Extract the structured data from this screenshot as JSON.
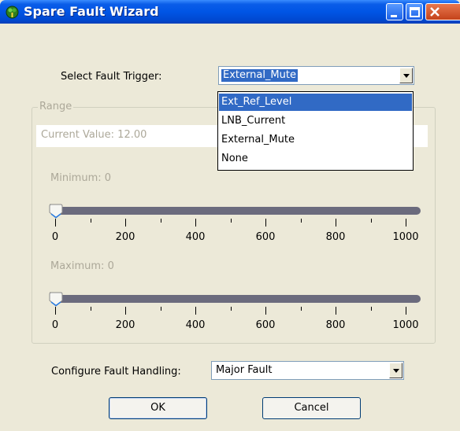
{
  "window": {
    "title": "Spare Fault Wizard"
  },
  "trigger": {
    "label": "Select Fault Trigger:",
    "value": "External_Mute",
    "options": [
      "Ext_Ref_Level",
      "LNB_Current",
      "External_Mute",
      "None"
    ],
    "highlighted": "Ext_Ref_Level"
  },
  "range": {
    "title": "Range",
    "current_value": "Current Value: 12.00",
    "minimum": {
      "label": "Minimum: 0",
      "value": 0
    },
    "maximum": {
      "label": "Maximum: 0",
      "value": 0
    },
    "scale": {
      "min": 0,
      "max": 1000,
      "labels": [
        "0",
        "200",
        "400",
        "600",
        "800",
        "1000"
      ]
    }
  },
  "handling": {
    "label": "Configure Fault Handling:",
    "value": "Major Fault"
  },
  "buttons": {
    "ok": "OK",
    "cancel": "Cancel"
  },
  "colors": {
    "titlebar": "#0055e5",
    "selection": "#316ac5",
    "track": "#6b6b7d",
    "face": "#ece9d8"
  }
}
